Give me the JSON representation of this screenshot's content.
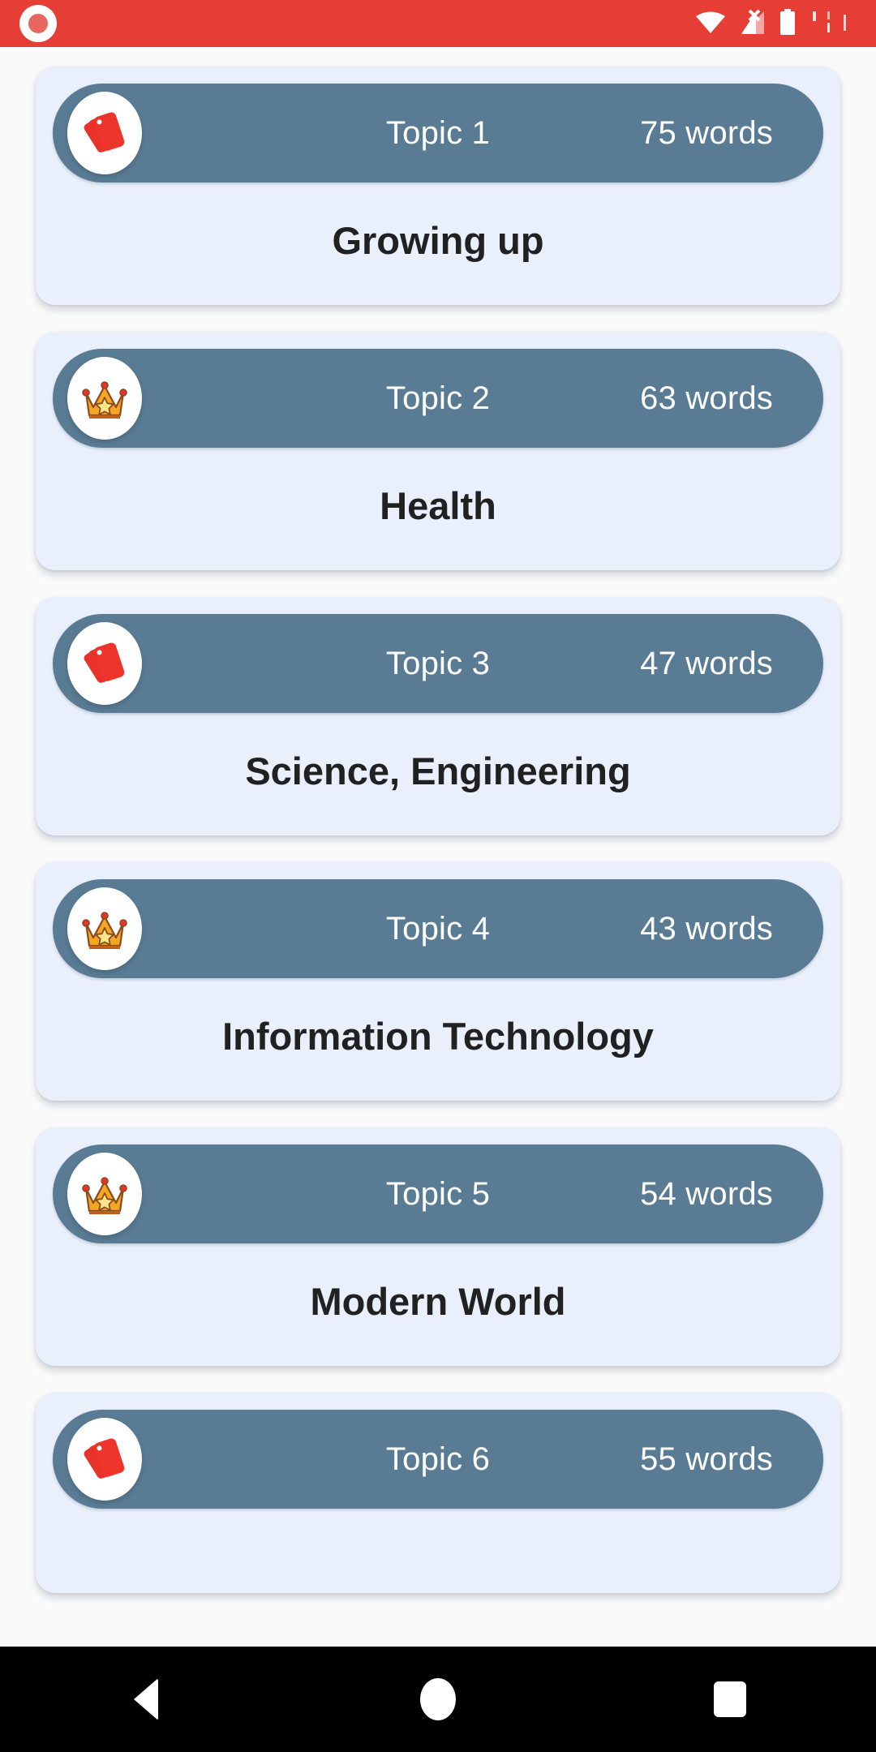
{
  "status_bar": {
    "background_color": "#E63D35",
    "recording_indicator": "screen-recording-dot",
    "icons": [
      "wifi-icon",
      "cellular-signal-off-icon",
      "battery-icon",
      "clock-icon"
    ]
  },
  "theme": {
    "page_background": "#FAFAFA",
    "card_background": "#E9EFFB",
    "header_pill": "#597C94",
    "header_text": "#FFFFFF",
    "title_text": "#212121",
    "badge_background": "#FFFFFF",
    "flashcard_icon_color": "#E8322A",
    "crown_icon_color": "#F5A623",
    "nav_bar_background": "#000000"
  },
  "topics": [
    {
      "label": "Topic 1",
      "words": "75 words",
      "title": "Growing up",
      "icon": "flashcards-icon"
    },
    {
      "label": "Topic 2",
      "words": "63 words",
      "title": "Health",
      "icon": "crown-icon"
    },
    {
      "label": "Topic 3",
      "words": "47 words",
      "title": "Science, Engineering",
      "icon": "flashcards-icon"
    },
    {
      "label": "Topic 4",
      "words": "43 words",
      "title": "Information Technology",
      "icon": "crown-icon"
    },
    {
      "label": "Topic 5",
      "words": "54 words",
      "title": "Modern World",
      "icon": "crown-icon"
    },
    {
      "label": "Topic 6",
      "words": "55 words",
      "title": "",
      "icon": "flashcards-icon"
    }
  ],
  "nav_bar": {
    "back_label": "Back",
    "home_label": "Home",
    "recents_label": "Recents"
  }
}
